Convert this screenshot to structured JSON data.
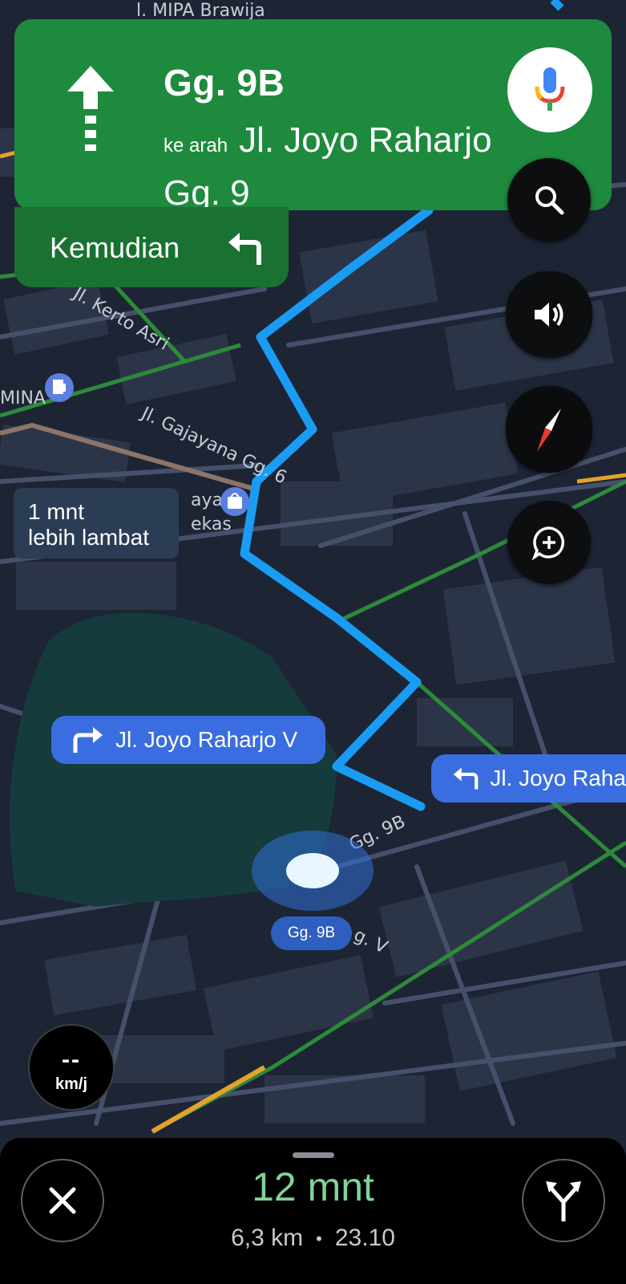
{
  "navigation": {
    "current_street": "Gg. 9B",
    "toward_prefix": "ke arah",
    "toward_street": "Jl. Joyo Raharjo Gg. 9",
    "then_label": "Kemudian"
  },
  "map": {
    "labels": {
      "top": "l. MIPA Brawija",
      "kerto": "Jl. Kerto Asri",
      "mina": "MINA",
      "gajayana": "Jl. Gajayana Gg. 6",
      "aya": "aya",
      "ekas": "ekas",
      "gg9b": "Gg. 9B",
      "ggv": "g. V"
    },
    "slower_route": {
      "line1": "1 mnt",
      "line2": "lebih lambat"
    },
    "turn_callout_right": "Jl. Joyo Raharjo V",
    "turn_callout_left": "Jl. Joyo Raha",
    "location_label": "Gg. 9B"
  },
  "speed": {
    "value": "--",
    "unit": "km/j"
  },
  "trip": {
    "eta": "12 mnt",
    "distance": "6,3 km",
    "arrival": "23.10",
    "separator": "•"
  },
  "colors": {
    "banner": "#1e8a3e",
    "banner_dark": "#197232",
    "route": "#1a9cf4",
    "callout": "#3a6ee0",
    "eta_green": "#7fd39a"
  }
}
